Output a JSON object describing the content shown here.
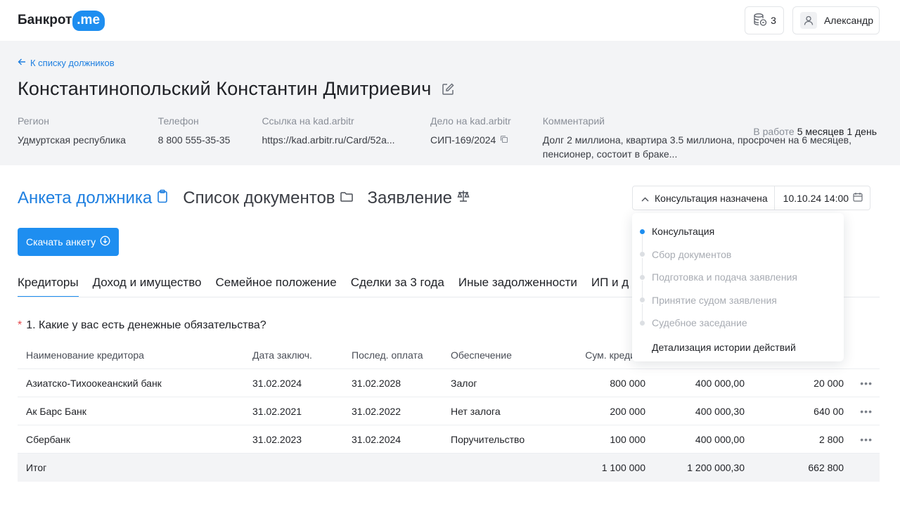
{
  "header": {
    "logo_text": "Банкрот",
    "logo_badge": ".me",
    "coins_count": "3",
    "user_name": "Александр"
  },
  "debtor": {
    "back_link": "К списку должников",
    "name": "Константинопольский Константин Дмитриевич",
    "work_label": "В работе",
    "work_value": "5 месяцев 1 день",
    "fields": [
      {
        "label": "Регион",
        "value": "Удмуртская республика"
      },
      {
        "label": "Телефон",
        "value": "8 800 555-35-35"
      },
      {
        "label": "Ссылка на kad.arbitr",
        "value": "https://kad.arbitr.ru/Card/52a..."
      },
      {
        "label": "Дело на  kad.arbitr",
        "value": "СИП-169/2024"
      },
      {
        "label": "Комментарий",
        "value": "Долг 2 миллиона, квартира 3.5 миллиона, просрочен на 6 месяцев, пенсионер, состоит в браке..."
      }
    ]
  },
  "section_tabs": [
    "Анкета должника",
    "Список документов",
    "Заявление"
  ],
  "status": {
    "current": "Консультация назначена",
    "date": "10.10.24 14:00",
    "steps": [
      "Консультация",
      "Сбор документов",
      "Подготовка и подача заявления",
      "Принятие судом заявления",
      "Судебное заседание"
    ],
    "history_link": "Детализация истории действий"
  },
  "download_button": "Скачать анкету",
  "subtabs": [
    "Кредиторы",
    "Доход и имущество",
    "Семейное положение",
    "Сделки за 3 года",
    "Иные задолженности",
    "ИП и д"
  ],
  "question": {
    "required_mark": "*",
    "text": "1. Какие у вас есть денежные обязательства?"
  },
  "table": {
    "headers": [
      "Наименование кредитора",
      "Дата заключ.",
      "Послед. оплата",
      "Обеспечение",
      "Сум. кредита",
      "",
      ""
    ],
    "rows": [
      [
        "Азиатско-Тихоокеанский банк",
        "31.02.2024",
        "31.02.2028",
        "Залог",
        "800 000",
        "400 000,00",
        "20 000"
      ],
      [
        "Ак Барс Банк",
        "31.02.2021",
        "31.02.2022",
        "Нет залога",
        "200 000",
        "400 000,30",
        "640 00"
      ],
      [
        "Сбербанк",
        "31.02.2023",
        "31.02.2024",
        "Поручительство",
        "100 000",
        "400 000,00",
        "2 800"
      ]
    ],
    "more": "•••",
    "total": [
      "Итог",
      "",
      "",
      "",
      "1 100 000",
      "1 200 000,30",
      "662 800"
    ]
  }
}
